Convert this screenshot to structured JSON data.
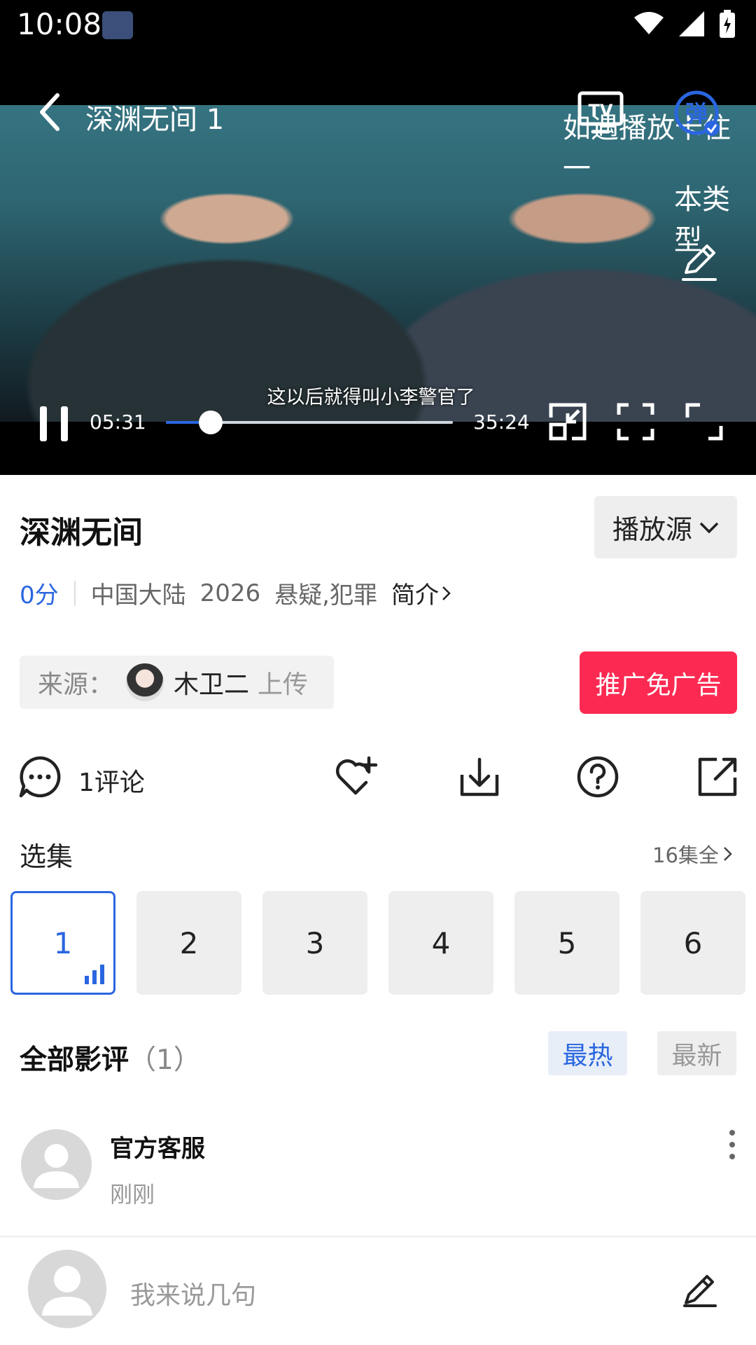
{
  "status_bar": {
    "time": "10:08"
  },
  "player": {
    "title": "深渊无间 1",
    "overlay_text_1": "如遇播放卡住一",
    "overlay_text_2": "本类型",
    "danmu_label": "弹",
    "tv_label": "TV",
    "subtitle": "这以后就得叫小李警官了",
    "current_time": "05:31",
    "total_time": "35:24",
    "progress": 0.156
  },
  "show": {
    "title": "深渊无间",
    "source_button": "播放源",
    "score": "0分",
    "region": "中国大陆",
    "year": "2026",
    "genres": "悬疑,犯罪",
    "intro_link": "简介"
  },
  "uploader": {
    "label": "来源：",
    "name": "木卫二",
    "suffix": "上传"
  },
  "promo_button": "推广免广告",
  "actions": {
    "comment_count": "1评论"
  },
  "episodes": {
    "label": "选集",
    "all_label": "16集全",
    "items": [
      "1",
      "2",
      "3",
      "4",
      "5",
      "6"
    ],
    "active_index": 0
  },
  "reviews": {
    "title": "全部影评",
    "count": "（1）",
    "sort_hot": "最热",
    "sort_new": "最新",
    "items": [
      {
        "name": "官方客服",
        "time": "刚刚"
      }
    ]
  },
  "comment_input": {
    "placeholder": "我来说几句"
  },
  "colors": {
    "accent": "#2a66e0",
    "promo": "#fc2a52"
  }
}
